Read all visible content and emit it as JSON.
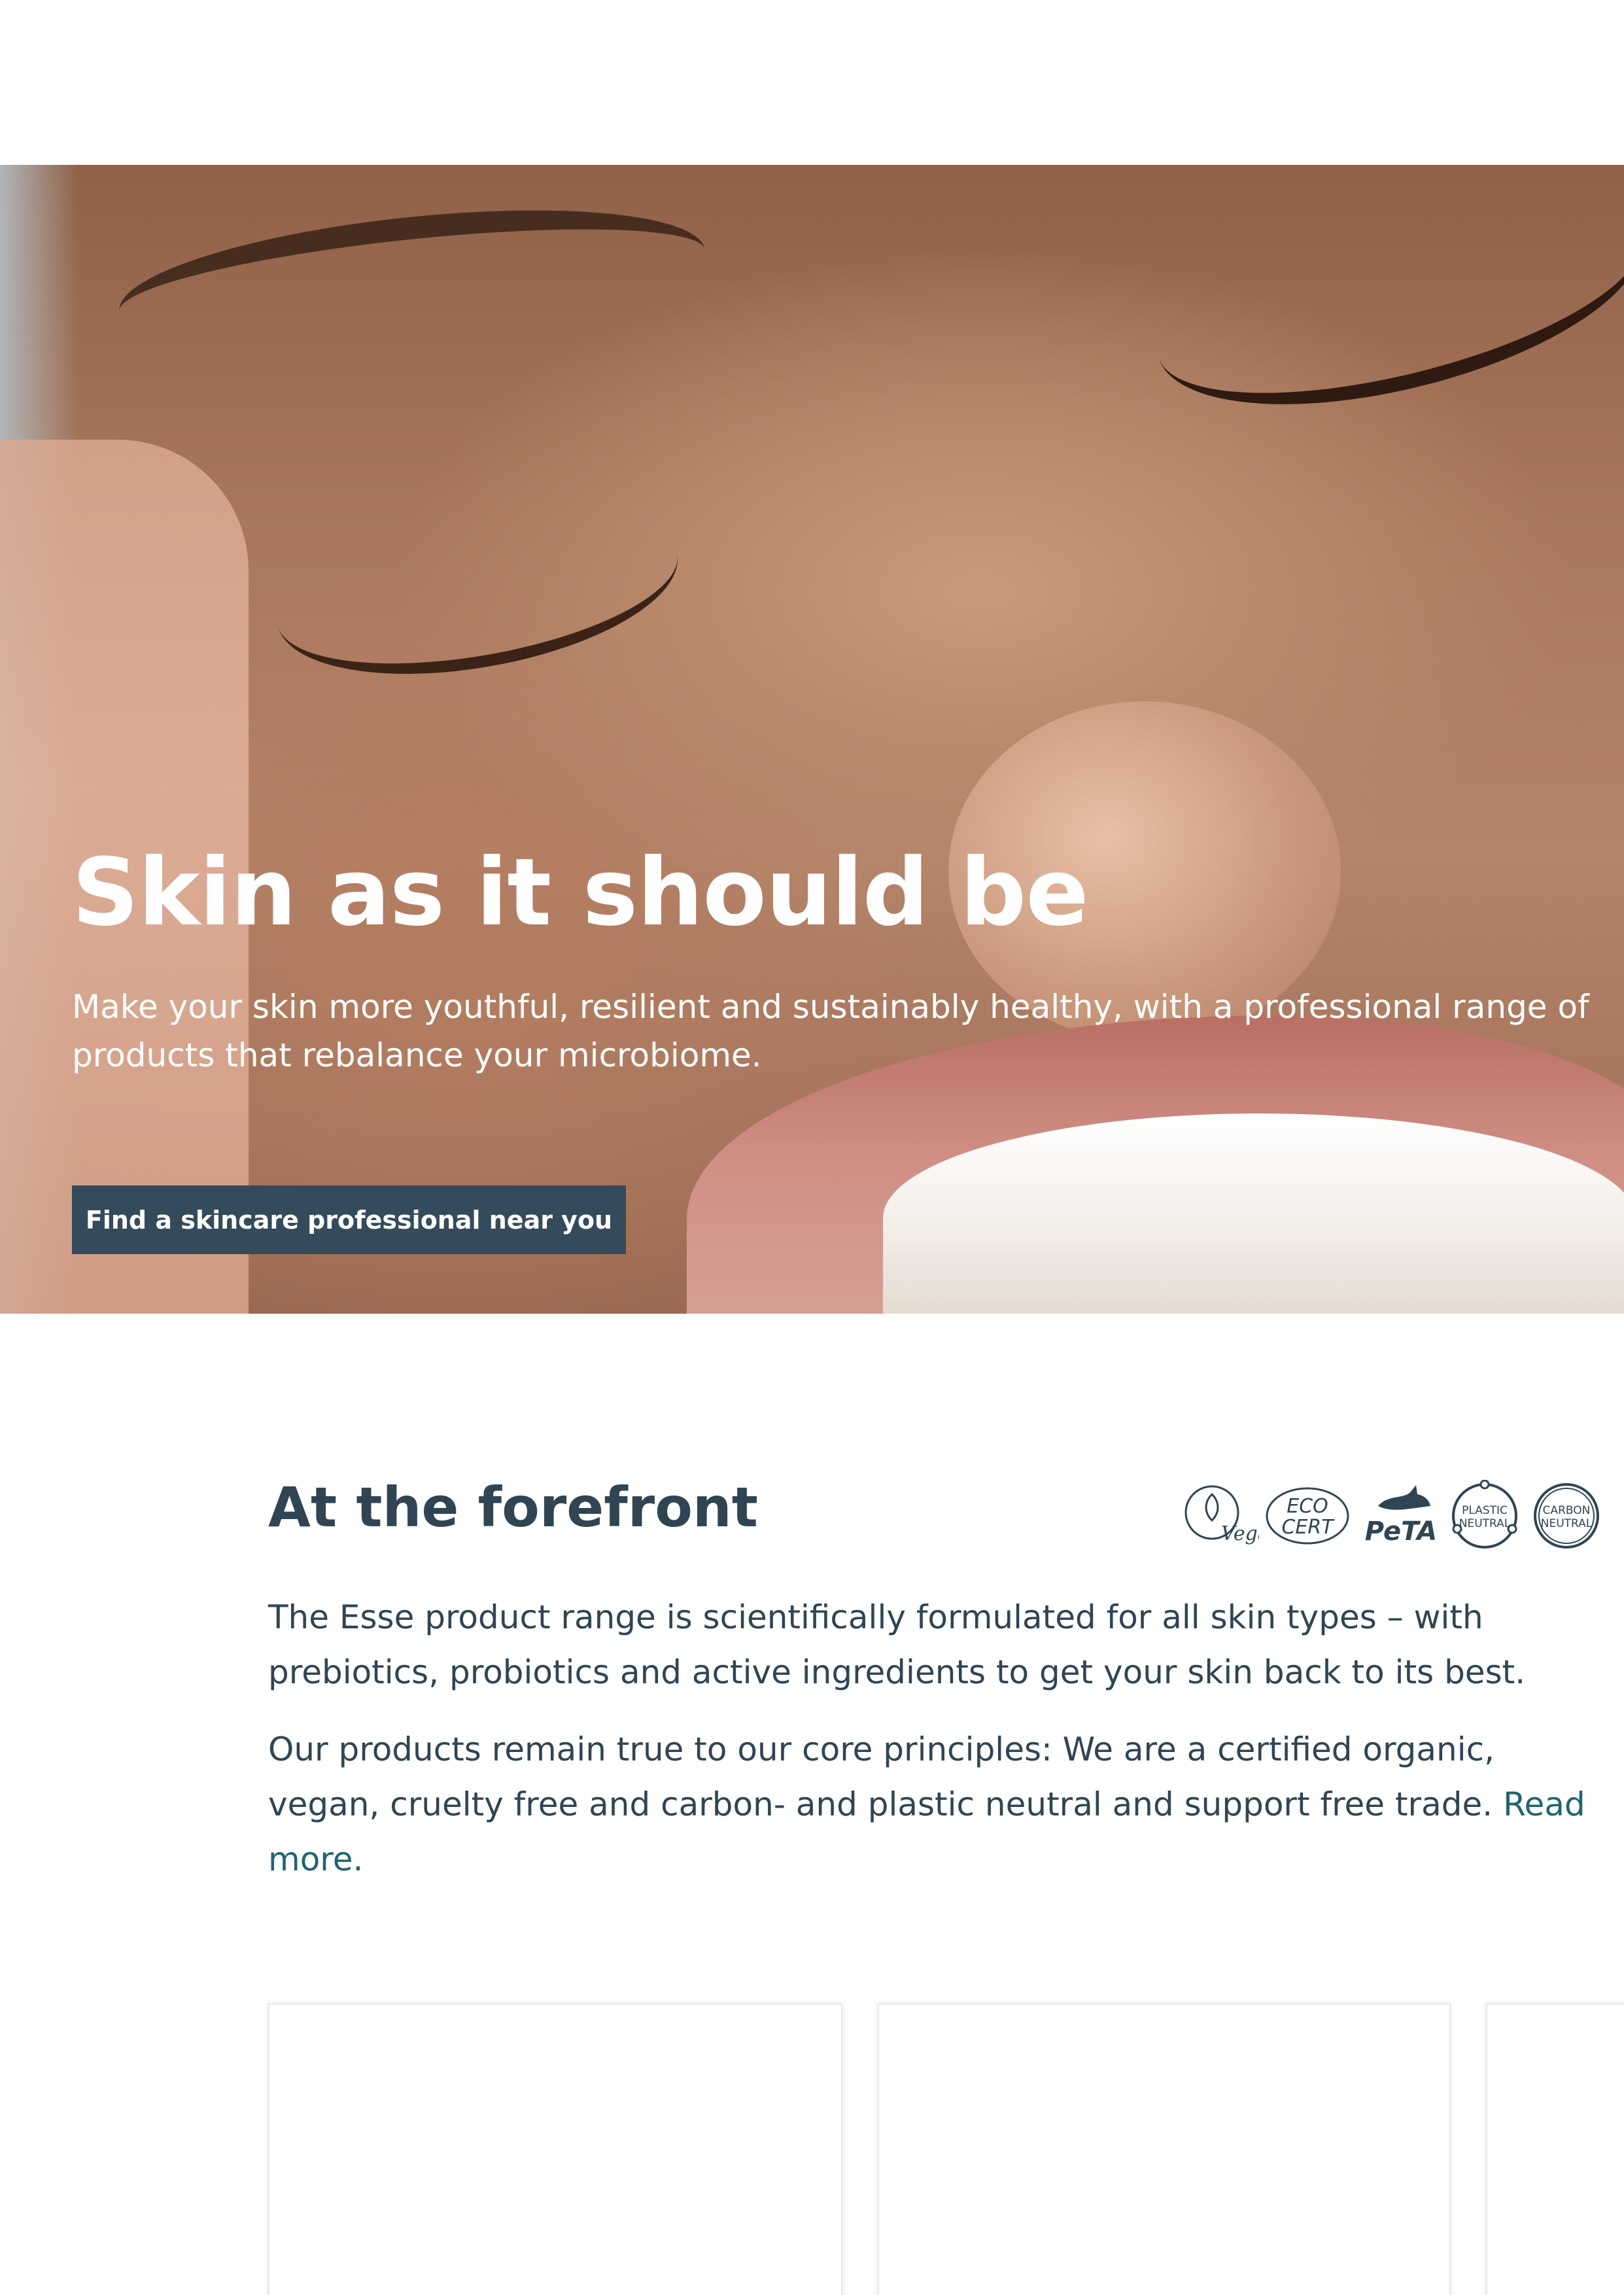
{
  "hero": {
    "title": "Skin as it should be",
    "subtitle": "Make your skin more youthful, resilient and sustainably healthy, with a professional range of products that rebalance your microbiome.",
    "cta_label": "Find a skincare professional near you",
    "cta_color": "#344b5c"
  },
  "forefront": {
    "title": "At the forefront",
    "paragraph_1": "The Esse product range is scientifically formulated for all skin types – with prebiotics, probiotics and active ingredients to get your skin back to its best.",
    "paragraph_2": "Our products remain true to our core principles: We are a certified organic, vegan, cruelty free and carbon- and plastic neutral and support free trade.",
    "read_more_label": "Read more.",
    "link_color": "#1f6570",
    "text_color": "#2f4554",
    "badges": [
      {
        "icon": "vegan-badge-icon",
        "label": "Vegan"
      },
      {
        "icon": "ecocert-badge-icon",
        "label_line_1": "ECO",
        "label_line_2": "CERT"
      },
      {
        "icon": "peta-badge-icon",
        "label": "PeTA"
      },
      {
        "icon": "plastic-neutral-badge-icon",
        "label_line_1": "PLASTIC",
        "label_line_2": "NEUTRAL"
      },
      {
        "icon": "carbon-neutral-badge-icon",
        "label_line_1": "CARBON",
        "label_line_2": "NEUTRAL"
      }
    ]
  },
  "cards": [
    {
      "icon": "product-card"
    },
    {
      "icon": "product-card"
    },
    {
      "icon": "product-card"
    }
  ]
}
